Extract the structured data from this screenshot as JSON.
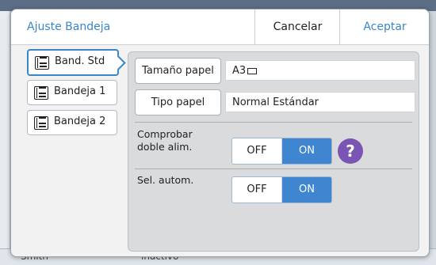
{
  "background": {
    "status_left": "Smith",
    "status_mid": "inactivo"
  },
  "dialog": {
    "title": "Ajuste Bandeja",
    "cancel_label": "Cancelar",
    "accept_label": "Aceptar"
  },
  "trays": [
    {
      "label": "Band. Std",
      "selected": true
    },
    {
      "label": "Bandeja 1",
      "selected": false
    },
    {
      "label": "Bandeja 2",
      "selected": false
    }
  ],
  "settings": {
    "paper_size": {
      "button_label": "Tamaño papel",
      "value": "A3"
    },
    "paper_type": {
      "button_label": "Tipo papel",
      "value": "Normal Estándar"
    },
    "double_feed": {
      "label_line1": "Comprobar",
      "label_line2": "doble alim.",
      "off_label": "OFF",
      "on_label": "ON",
      "state": "ON"
    },
    "auto_select": {
      "label": "Sel. autom.",
      "off_label": "OFF",
      "on_label": "ON",
      "state": "ON"
    },
    "help_symbol": "?"
  },
  "colors": {
    "accent": "#3b86c6",
    "toggle_on": "#3f85d0",
    "help": "#7b55b4"
  }
}
